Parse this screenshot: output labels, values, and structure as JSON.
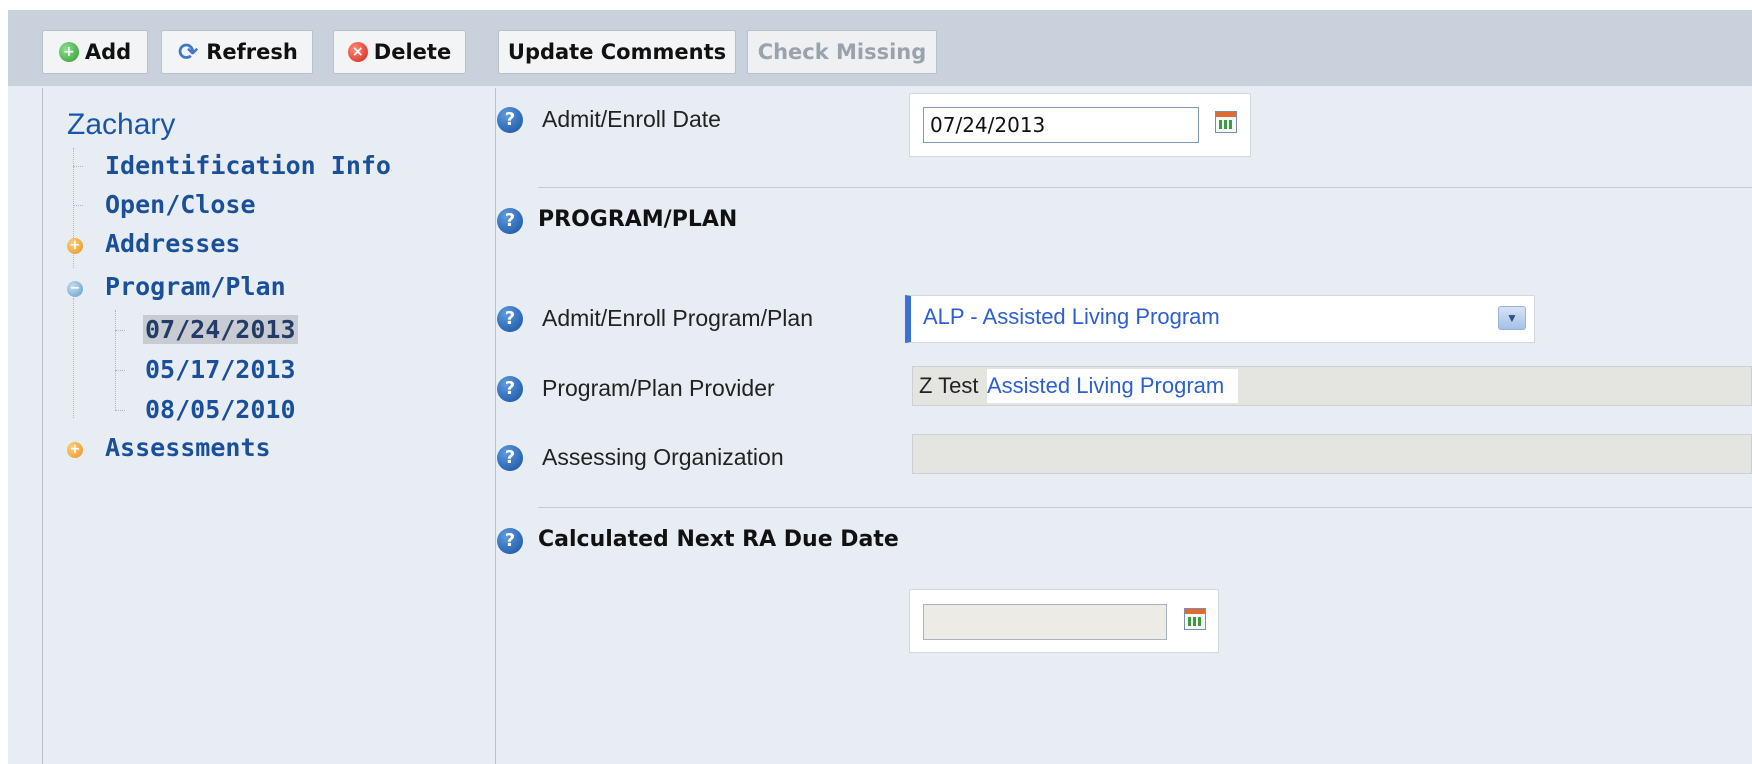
{
  "toolbar": {
    "add_label": "Add",
    "refresh_label": "Refresh",
    "delete_label": "Delete",
    "update_comments_label": "Update Comments",
    "check_missing_label": "Check Missing"
  },
  "tree": {
    "root": "Zachary",
    "items": [
      {
        "label": "Identification Info"
      },
      {
        "label": "Open/Close"
      },
      {
        "label": "Addresses"
      },
      {
        "label": "Program/Plan"
      },
      {
        "label": "07/24/2013"
      },
      {
        "label": "05/17/2013"
      },
      {
        "label": "08/05/2010"
      },
      {
        "label": "Assessments"
      }
    ]
  },
  "form": {
    "admit_enroll_date_label": "Admit/Enroll Date",
    "admit_enroll_date_value": "07/24/2013",
    "program_plan_section": "PROGRAM/PLAN",
    "admit_enroll_program_label": "Admit/Enroll Program/Plan",
    "admit_enroll_program_value": "ALP - Assisted Living Program",
    "provider_label": "Program/Plan Provider",
    "provider_prefix": "Z Test",
    "provider_value": "Assisted Living Program",
    "assessing_org_label": "Assessing Organization",
    "assessing_org_value": "",
    "next_ra_section": "Calculated Next RA Due Date",
    "next_ra_value": ""
  },
  "icons": {
    "help": "?",
    "add": "+",
    "delete": "×",
    "refresh": "⟳",
    "expand": "+",
    "collapse": "−",
    "dropdown": "▼"
  },
  "colors": {
    "accent_link": "#2c5fd0",
    "tree_text": "#1a4f9a",
    "toolbar_bg": "#c9d2dc",
    "panel_bg": "#e8edf4"
  }
}
